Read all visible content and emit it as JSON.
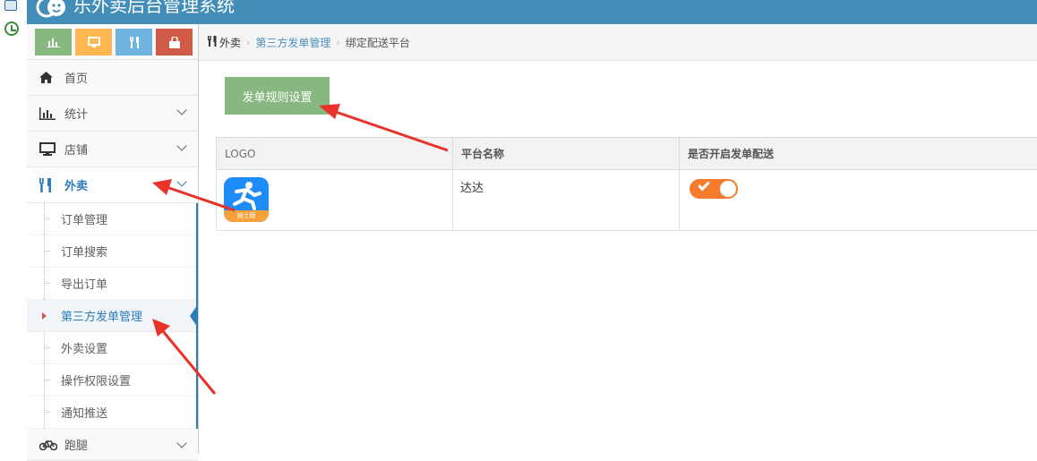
{
  "app": {
    "title": "乐外卖后台管理系统"
  },
  "shortcuts": [
    {
      "name": "stats-shortcut",
      "icon": "bar-chart-icon",
      "color": "#87b87f"
    },
    {
      "name": "monitor-shortcut",
      "icon": "desktop-icon",
      "color": "#ffb752"
    },
    {
      "name": "food-shortcut",
      "icon": "cutlery-icon",
      "color": "#6fb3e0"
    },
    {
      "name": "shop-shortcut",
      "icon": "shopping-bag-icon",
      "color": "#d15b47"
    }
  ],
  "sidebar": {
    "items": [
      {
        "label": "首页",
        "icon": "home-icon"
      },
      {
        "label": "统计",
        "icon": "bar-chart-icon"
      },
      {
        "label": "店铺",
        "icon": "desktop-icon"
      },
      {
        "label": "外卖",
        "icon": "cutlery-icon",
        "active": true
      },
      {
        "label": "跑腿",
        "icon": "bicycle-icon"
      }
    ],
    "submenu": [
      {
        "label": "订单管理"
      },
      {
        "label": "订单搜索"
      },
      {
        "label": "导出订单"
      },
      {
        "label": "第三方发单管理",
        "current": true
      },
      {
        "label": "外卖设置"
      },
      {
        "label": "操作权限设置"
      },
      {
        "label": "通知推送"
      }
    ]
  },
  "breadcrumb": {
    "root": "外卖",
    "parent": "第三方发单管理",
    "current": "绑定配送平台"
  },
  "main": {
    "rule_button": "发单规则设置",
    "table": {
      "headers": [
        "LOGO",
        "平台名称",
        "是否开启发单配送"
      ],
      "rows": [
        {
          "logo_caption": "骑士版",
          "platform": "达达",
          "enabled": true
        }
      ]
    }
  },
  "colors": {
    "header": "#438eb9",
    "accent": "#2b7dbc",
    "button": "#87b87f",
    "toggle_on": "#f57c2d",
    "arrow": "#e8322a"
  }
}
